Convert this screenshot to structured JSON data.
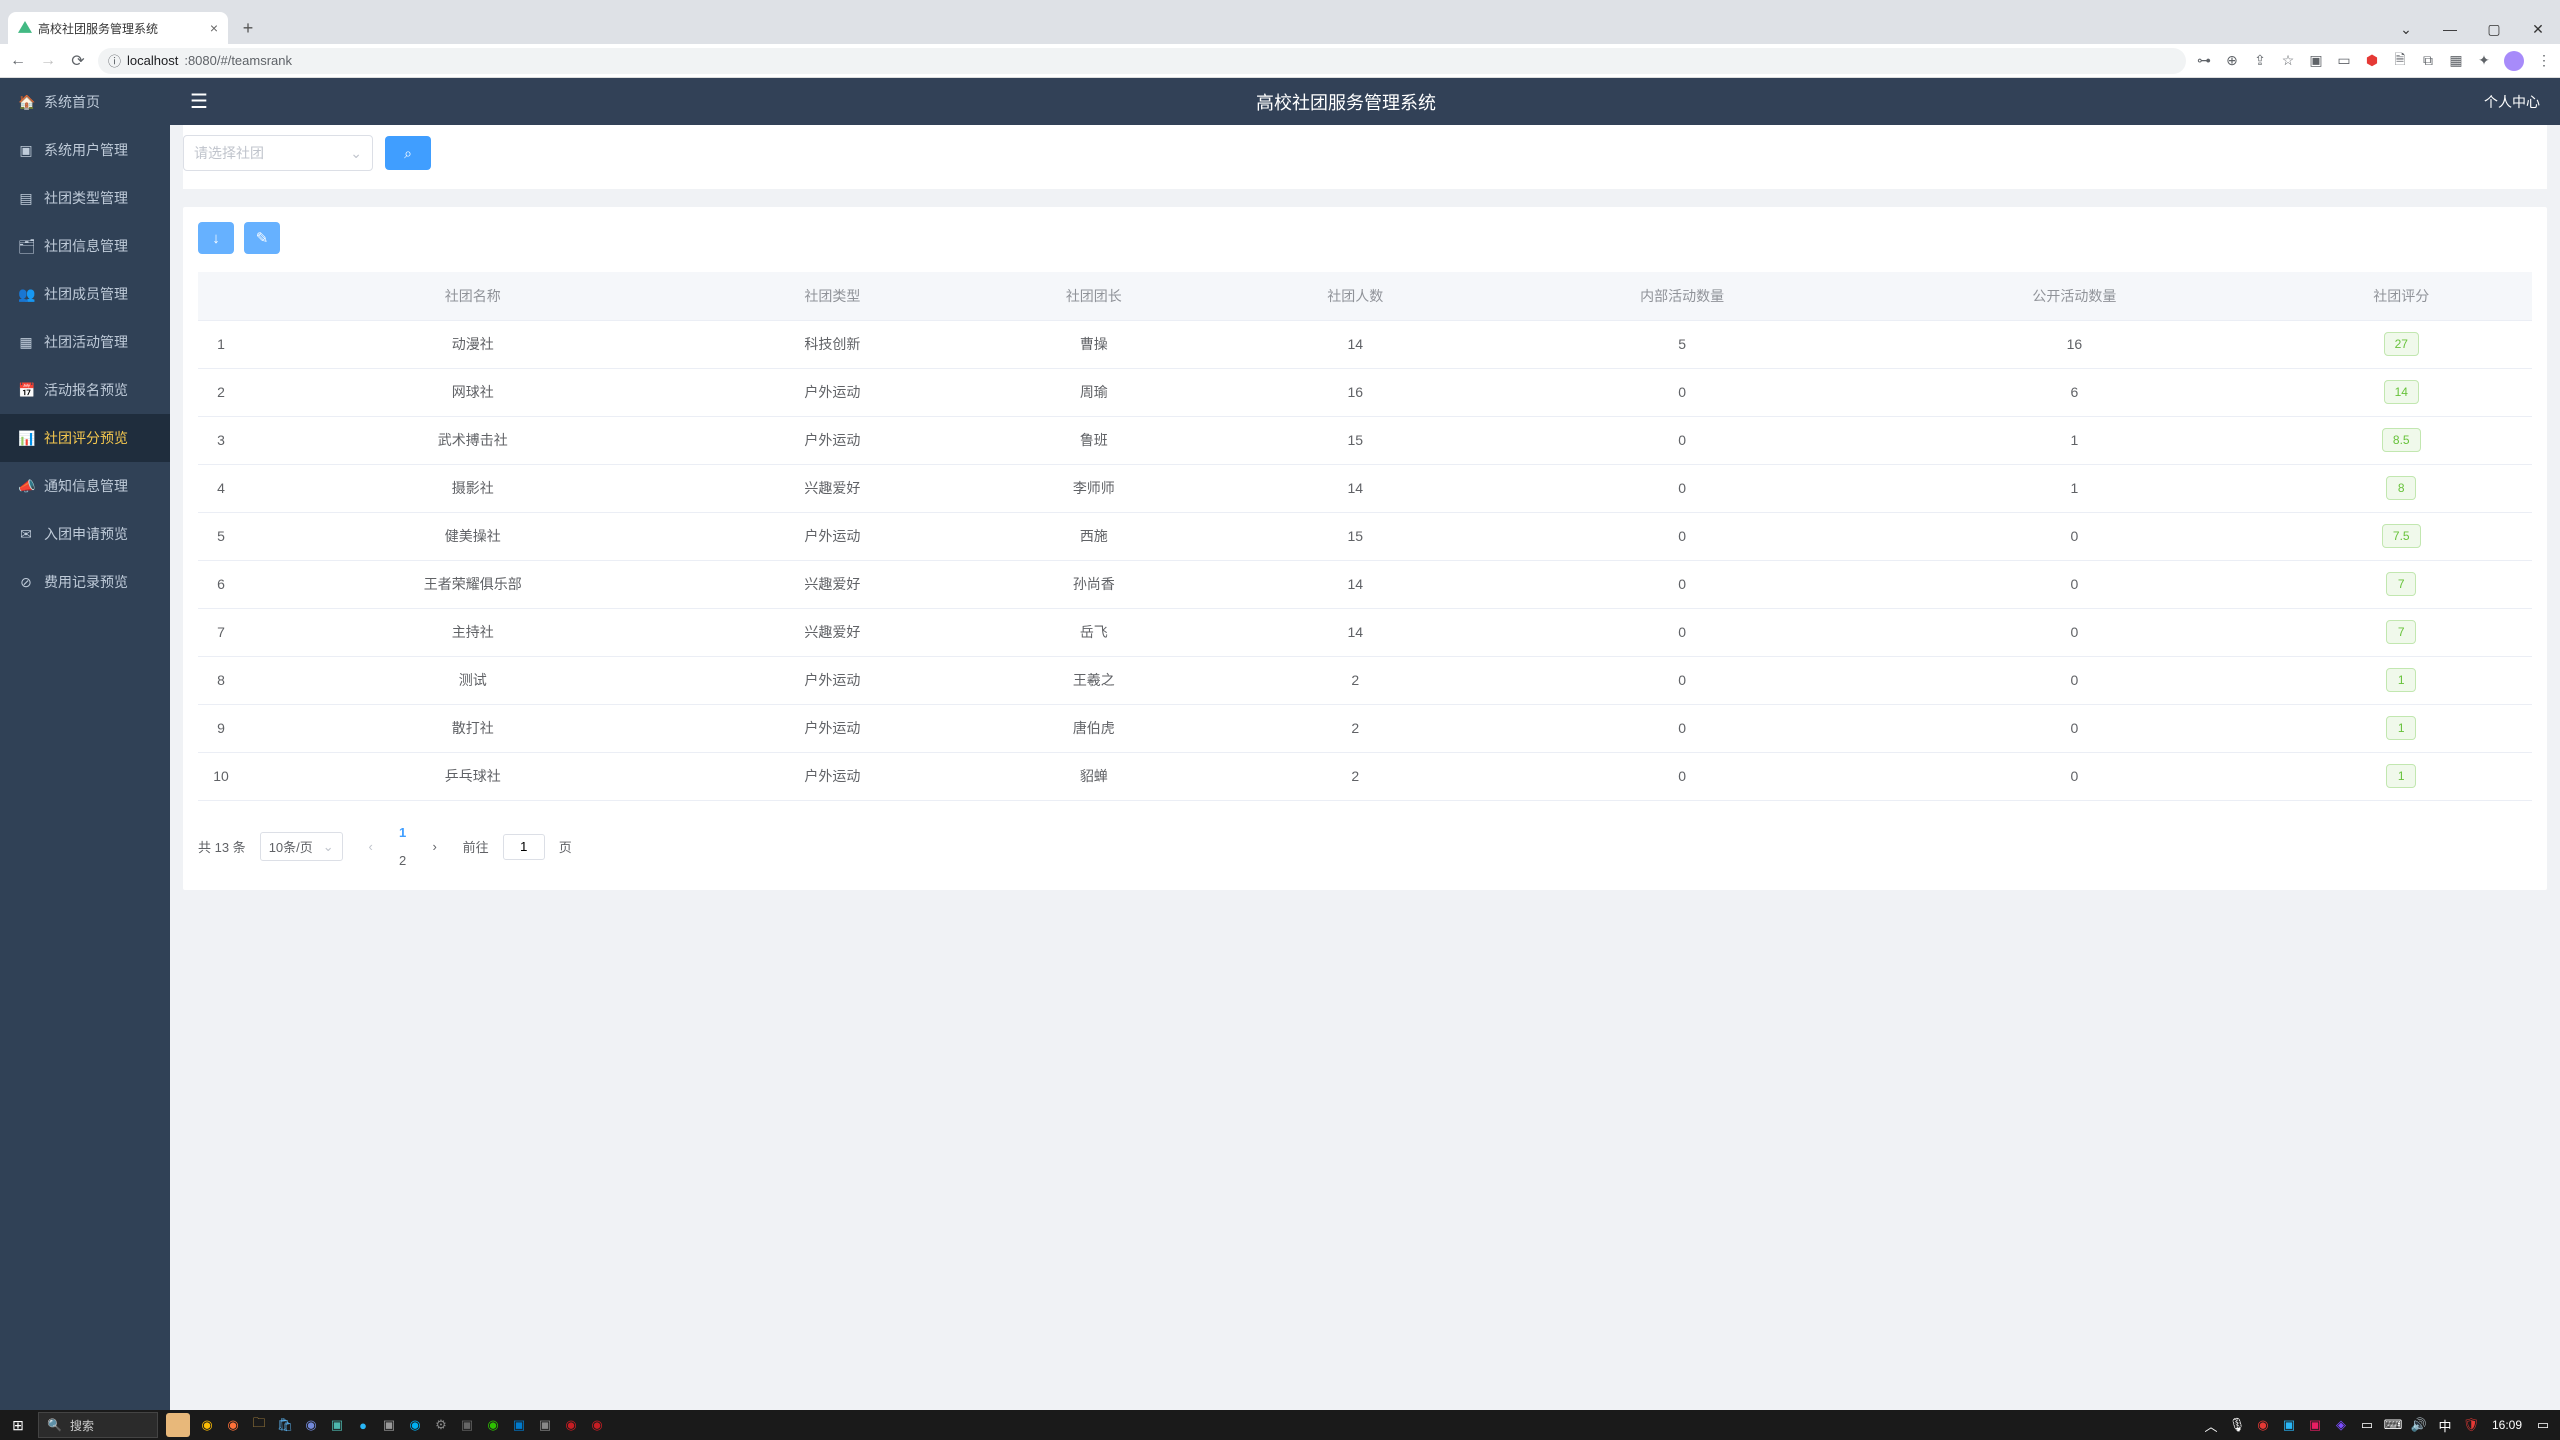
{
  "browser": {
    "tab_title": "高校社团服务管理系统",
    "url_prefix": "localhost",
    "url_path": ":8080/#/teamsrank"
  },
  "window_controls": {
    "min": "—",
    "max": "▢",
    "close": "✕"
  },
  "header": {
    "title": "高校社团服务管理系统",
    "user_menu": "个人中心"
  },
  "sidebar": {
    "items": [
      {
        "icon": "🏠",
        "label": "系统首页",
        "name": "home"
      },
      {
        "icon": "▣",
        "label": "系统用户管理",
        "name": "users"
      },
      {
        "icon": "▤",
        "label": "社团类型管理",
        "name": "types"
      },
      {
        "icon": "🗂",
        "label": "社团信息管理",
        "name": "info"
      },
      {
        "icon": "👥",
        "label": "社团成员管理",
        "name": "members"
      },
      {
        "icon": "▦",
        "label": "社团活动管理",
        "name": "activities"
      },
      {
        "icon": "📅",
        "label": "活动报名预览",
        "name": "signup"
      },
      {
        "icon": "📊",
        "label": "社团评分预览",
        "name": "ranking"
      },
      {
        "icon": "📣",
        "label": "通知信息管理",
        "name": "notify"
      },
      {
        "icon": "✉",
        "label": "入团申请预览",
        "name": "apply"
      },
      {
        "icon": "⊘",
        "label": "费用记录预览",
        "name": "fee"
      }
    ],
    "active_index": 7
  },
  "filter": {
    "select_placeholder": "请选择社团"
  },
  "table": {
    "headers": [
      "社团名称",
      "社团类型",
      "社团团长",
      "社团人数",
      "内部活动数量",
      "公开活动数量",
      "社团评分"
    ],
    "rows": [
      {
        "idx": "1",
        "name": "动漫社",
        "type": "科技创新",
        "leader": "曹操",
        "members": "14",
        "internal": "5",
        "public": "16",
        "score": "27"
      },
      {
        "idx": "2",
        "name": "网球社",
        "type": "户外运动",
        "leader": "周瑜",
        "members": "16",
        "internal": "0",
        "public": "6",
        "score": "14"
      },
      {
        "idx": "3",
        "name": "武术搏击社",
        "type": "户外运动",
        "leader": "鲁班",
        "members": "15",
        "internal": "0",
        "public": "1",
        "score": "8.5"
      },
      {
        "idx": "4",
        "name": "摄影社",
        "type": "兴趣爱好",
        "leader": "李师师",
        "members": "14",
        "internal": "0",
        "public": "1",
        "score": "8"
      },
      {
        "idx": "5",
        "name": "健美操社",
        "type": "户外运动",
        "leader": "西施",
        "members": "15",
        "internal": "0",
        "public": "0",
        "score": "7.5"
      },
      {
        "idx": "6",
        "name": "王者荣耀俱乐部",
        "type": "兴趣爱好",
        "leader": "孙尚香",
        "members": "14",
        "internal": "0",
        "public": "0",
        "score": "7"
      },
      {
        "idx": "7",
        "name": "主持社",
        "type": "兴趣爱好",
        "leader": "岳飞",
        "members": "14",
        "internal": "0",
        "public": "0",
        "score": "7"
      },
      {
        "idx": "8",
        "name": "测试",
        "type": "户外运动",
        "leader": "王羲之",
        "members": "2",
        "internal": "0",
        "public": "0",
        "score": "1"
      },
      {
        "idx": "9",
        "name": "散打社",
        "type": "户外运动",
        "leader": "唐伯虎",
        "members": "2",
        "internal": "0",
        "public": "0",
        "score": "1"
      },
      {
        "idx": "10",
        "name": "乒乓球社",
        "type": "户外运动",
        "leader": "貂蝉",
        "members": "2",
        "internal": "0",
        "public": "0",
        "score": "1"
      }
    ]
  },
  "pagination": {
    "total_text": "共 13 条",
    "page_size": "10条/页",
    "pages": [
      "1",
      "2"
    ],
    "current": 1,
    "jump_prefix": "前往",
    "jump_value": "1",
    "jump_suffix": "页"
  },
  "taskbar": {
    "search_placeholder": "搜索",
    "time": "16:09"
  }
}
